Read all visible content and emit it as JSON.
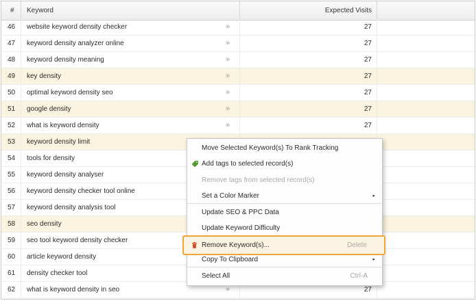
{
  "table": {
    "headers": {
      "num": "#",
      "keyword": "Keyword",
      "visits": "Expected Visits"
    },
    "rows": [
      {
        "num": "46",
        "keyword": "website keyword density checker",
        "visits": "27",
        "highlighted": false,
        "arrow": true
      },
      {
        "num": "47",
        "keyword": "keyword density analyzer online",
        "visits": "27",
        "highlighted": false,
        "arrow": true
      },
      {
        "num": "48",
        "keyword": "keyword density meaning",
        "visits": "27",
        "highlighted": false,
        "arrow": true
      },
      {
        "num": "49",
        "keyword": "key density",
        "visits": "27",
        "highlighted": true,
        "arrow": true
      },
      {
        "num": "50",
        "keyword": "optimal keyword density seo",
        "visits": "27",
        "highlighted": false,
        "arrow": true
      },
      {
        "num": "51",
        "keyword": "google density",
        "visits": "27",
        "highlighted": true,
        "arrow": true
      },
      {
        "num": "52",
        "keyword": "what is keyword density",
        "visits": "27",
        "highlighted": false,
        "arrow": true
      },
      {
        "num": "53",
        "keyword": "keyword density limit",
        "visits": "",
        "highlighted": true,
        "arrow": false
      },
      {
        "num": "54",
        "keyword": "tools for density",
        "visits": "",
        "highlighted": false,
        "arrow": false
      },
      {
        "num": "55",
        "keyword": "keyword density analyser",
        "visits": "",
        "highlighted": false,
        "arrow": false
      },
      {
        "num": "56",
        "keyword": "keyword density checker tool online",
        "visits": "",
        "highlighted": false,
        "arrow": false
      },
      {
        "num": "57",
        "keyword": "keyword density analysis tool",
        "visits": "",
        "highlighted": false,
        "arrow": false
      },
      {
        "num": "58",
        "keyword": "seo density",
        "visits": "",
        "highlighted": true,
        "arrow": false
      },
      {
        "num": "59",
        "keyword": "seo tool keyword density checker",
        "visits": "",
        "highlighted": false,
        "arrow": false
      },
      {
        "num": "60",
        "keyword": "article keyword density",
        "visits": "",
        "highlighted": false,
        "arrow": false
      },
      {
        "num": "61",
        "keyword": "density checker tool",
        "visits": "",
        "highlighted": false,
        "arrow": false
      },
      {
        "num": "62",
        "keyword": "what is keyword density in seo",
        "visits": "27",
        "highlighted": false,
        "arrow": true
      }
    ],
    "arrow_glyph": "»",
    "highlight_color": "#faf3e0"
  },
  "context_menu": {
    "items": [
      {
        "label": "Move Selected Keyword(s) To Rank Tracking",
        "shortcut": "",
        "submenu": false,
        "disabled": false,
        "icon": "",
        "active": false
      },
      {
        "label": "Add tags to selected record(s)",
        "shortcut": "",
        "submenu": false,
        "disabled": false,
        "icon": "tag-icon",
        "active": false
      },
      {
        "label": "Remove tags from selected record(s)",
        "shortcut": "",
        "submenu": false,
        "disabled": true,
        "icon": "",
        "active": false
      },
      {
        "label": "Set a Color Marker",
        "shortcut": "",
        "submenu": true,
        "disabled": false,
        "icon": "",
        "active": false
      },
      {
        "label": "Update SEO & PPC Data",
        "shortcut": "",
        "submenu": false,
        "disabled": false,
        "icon": "",
        "active": false
      },
      {
        "label": "Update Keyword Difficulty",
        "shortcut": "",
        "submenu": false,
        "disabled": false,
        "icon": "",
        "active": false
      },
      {
        "label": "Remove Keyword(s)...",
        "shortcut": "Delete",
        "submenu": false,
        "disabled": false,
        "icon": "trash-icon",
        "active": true
      },
      {
        "label": "Copy To Clipboard",
        "shortcut": "",
        "submenu": true,
        "disabled": false,
        "icon": "",
        "active": false
      },
      {
        "label": "Select All",
        "shortcut": "Ctrl-A",
        "submenu": false,
        "disabled": false,
        "icon": "",
        "active": false
      }
    ],
    "active_border_color": "#f3a33c",
    "submenu_glyph": "▸"
  }
}
